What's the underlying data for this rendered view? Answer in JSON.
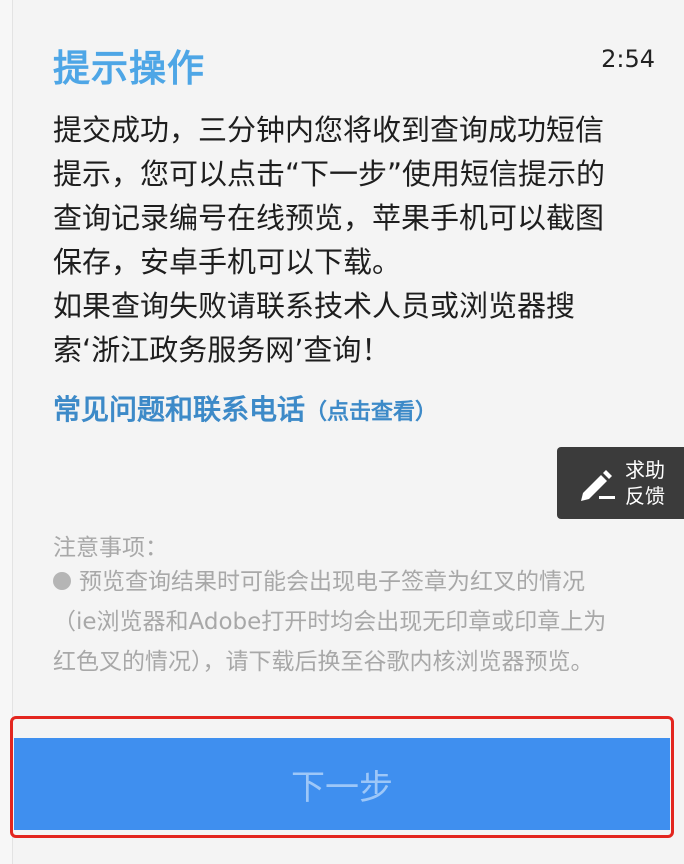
{
  "header": {
    "title": "提示操作",
    "time": "2:54"
  },
  "message": {
    "lines": [
      "提交成功，三分钟内您将收到查询成功短信",
      "提示，您可以点击“下一步”使用短信提示的",
      "查询记录编号在线预览，苹果手机可以截图",
      "保存，安卓手机可以下载。",
      "如果查询失败请联系技术人员或浏览器搜",
      "索‘浙江政务服务网’查询！"
    ]
  },
  "faq": {
    "label": "常见问题和联系电话",
    "hint": "（点击查看）"
  },
  "help_button": {
    "line1": "求助",
    "line2": "反馈",
    "icon": "pen-icon"
  },
  "notes": {
    "title": "注意事项：",
    "lines": [
      "预览查询结果时可能会出现电子签章为红叉的情况",
      "（ie浏览器和Adobe打开时均会出现无印章或印章上为",
      "红色叉的情况），请下载后换至谷歌内核浏览器预览。"
    ]
  },
  "next_button": {
    "label": "下一步"
  },
  "colors": {
    "title": "#4ea6e6",
    "link": "#3d8ac8",
    "button": "#3f8fef",
    "button_text": "#9dc7f8",
    "highlight": "#e3261f"
  }
}
